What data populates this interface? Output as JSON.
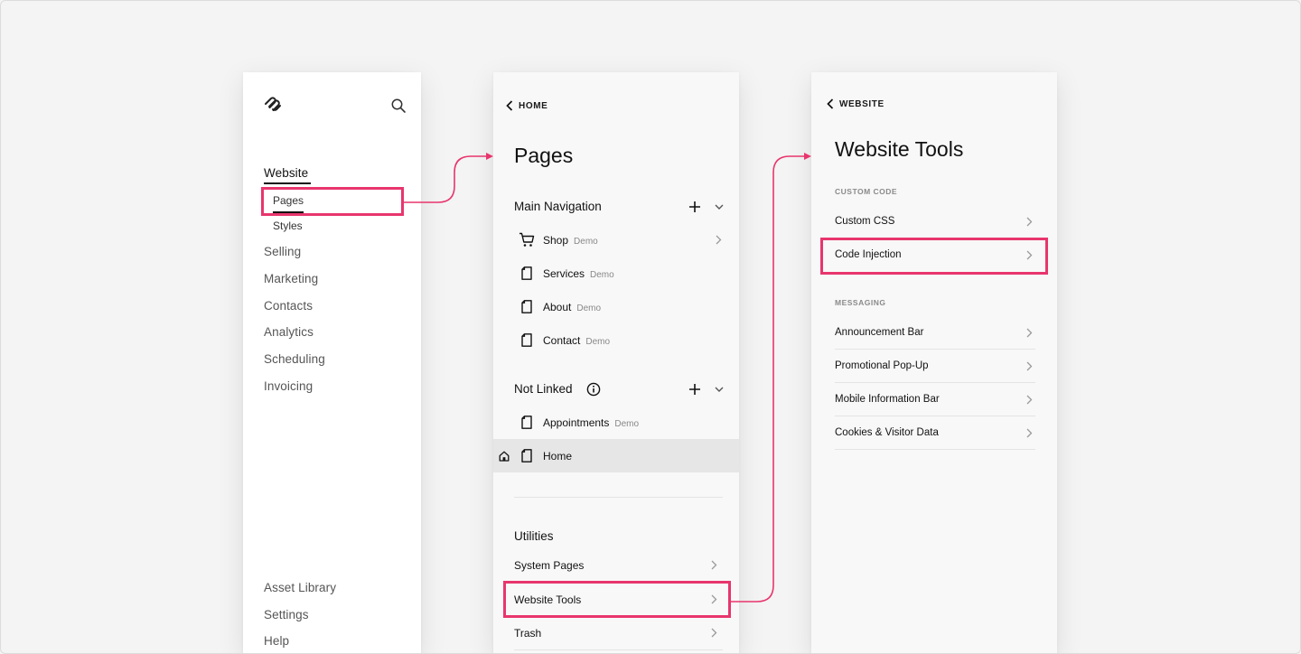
{
  "colors": {
    "accent": "#e8356d",
    "panel_bg": "#f8f8f8",
    "page_bg": "#f4f4f4",
    "selected_row": "#e6e6e6"
  },
  "panel1": {
    "logo_icon": "squarespace-logo",
    "search_icon": "search-icon",
    "nav": {
      "website": "Website",
      "pages": "Pages",
      "styles": "Styles",
      "selling": "Selling",
      "marketing": "Marketing",
      "contacts": "Contacts",
      "analytics": "Analytics",
      "scheduling": "Scheduling",
      "invoicing": "Invoicing"
    },
    "footer": {
      "asset_library": "Asset Library",
      "settings": "Settings",
      "help": "Help"
    }
  },
  "panel2": {
    "back_label": "HOME",
    "title": "Pages",
    "main_navigation": {
      "heading": "Main Navigation",
      "pages": [
        {
          "name": "Shop",
          "tag": "Demo",
          "icon": "cart-icon"
        },
        {
          "name": "Services",
          "tag": "Demo",
          "icon": "page-icon"
        },
        {
          "name": "About",
          "tag": "Demo",
          "icon": "page-icon"
        },
        {
          "name": "Contact",
          "tag": "Demo",
          "icon": "page-icon"
        }
      ]
    },
    "not_linked": {
      "heading": "Not Linked",
      "pages": [
        {
          "name": "Appointments",
          "tag": "Demo",
          "icon": "page-icon"
        },
        {
          "name": "Home",
          "tag": "",
          "icon": "page-icon",
          "is_homepage": true
        }
      ]
    },
    "utilities": {
      "heading": "Utilities",
      "items": [
        "System Pages",
        "Website Tools",
        "Trash"
      ]
    }
  },
  "panel3": {
    "back_label": "WEBSITE",
    "title": "Website Tools",
    "custom_code": {
      "label": "CUSTOM CODE",
      "items": [
        "Custom CSS",
        "Code Injection"
      ]
    },
    "messaging": {
      "label": "MESSAGING",
      "items": [
        "Announcement Bar",
        "Promotional Pop-Up",
        "Mobile Information Bar",
        "Cookies & Visitor Data"
      ]
    }
  }
}
